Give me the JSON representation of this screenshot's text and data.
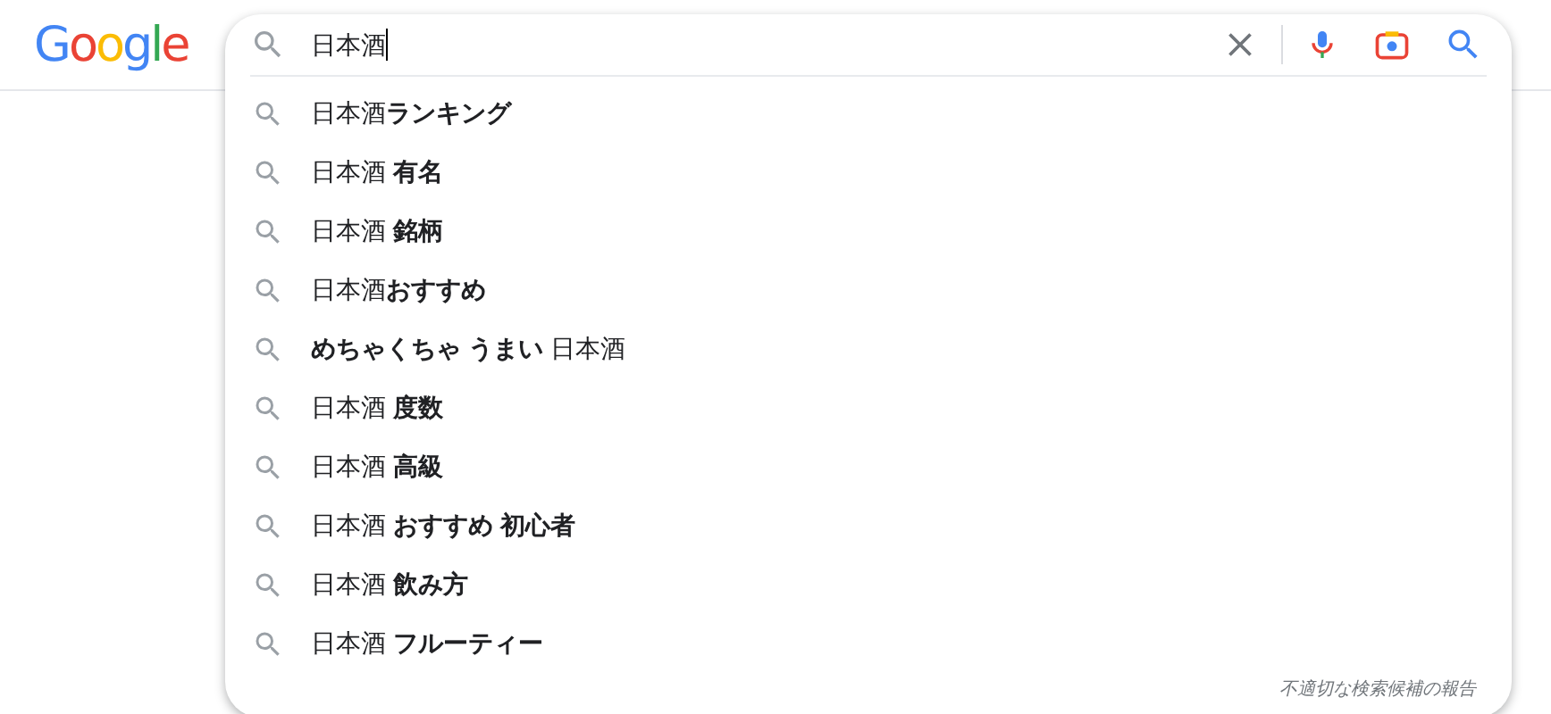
{
  "logo": {
    "letters": [
      {
        "text": "G",
        "color": "#4285f4"
      },
      {
        "text": "o",
        "color": "#ea4335"
      },
      {
        "text": "o",
        "color": "#fbbc05"
      },
      {
        "text": "g",
        "color": "#4285f4"
      },
      {
        "text": "l",
        "color": "#34a853"
      },
      {
        "text": "e",
        "color": "#ea4335"
      }
    ]
  },
  "search": {
    "value": "日本酒"
  },
  "suggestions": [
    {
      "text": "日本酒**ランキング**"
    },
    {
      "text": "日本酒 **有名**"
    },
    {
      "text": "日本酒 **銘柄**"
    },
    {
      "text": "日本酒**おすすめ**"
    },
    {
      "text": "**めちゃくちゃ うまい** 日本酒"
    },
    {
      "text": "日本酒 **度数**"
    },
    {
      "text": "日本酒 **高級**"
    },
    {
      "text": "日本酒 **おすすめ 初心者**"
    },
    {
      "text": "日本酒 **飲み方**"
    },
    {
      "text": "日本酒 **フルーティー**"
    }
  ],
  "report_link": "不適切な検索候補の報告"
}
